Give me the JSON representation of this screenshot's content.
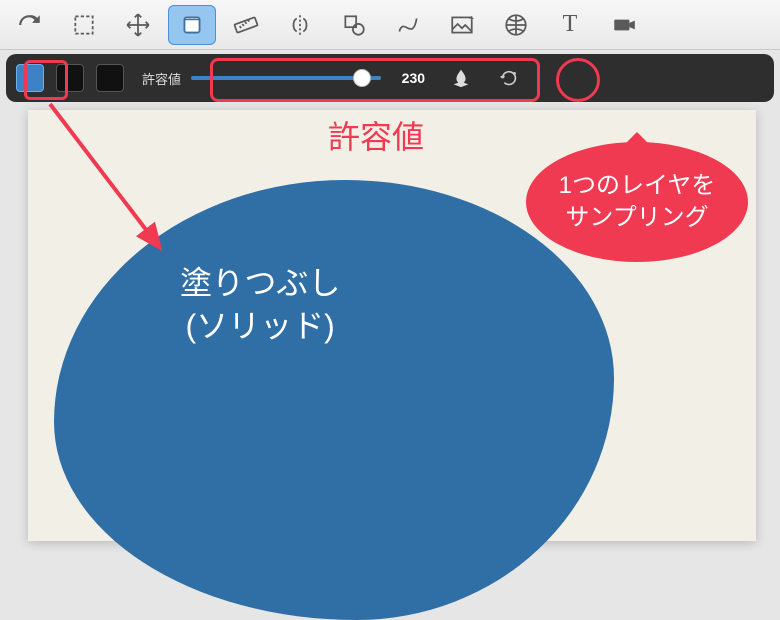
{
  "toolbar": {
    "tools": [
      {
        "name": "redo-arrow"
      },
      {
        "name": "marquee-select"
      },
      {
        "name": "move"
      },
      {
        "name": "fill-bucket",
        "selected": true
      },
      {
        "name": "ruler"
      },
      {
        "name": "symmetry"
      },
      {
        "name": "shape"
      },
      {
        "name": "curve"
      },
      {
        "name": "image-insert"
      },
      {
        "name": "perspective-grid"
      },
      {
        "name": "text"
      },
      {
        "name": "camera"
      }
    ]
  },
  "options": {
    "swatches": [
      {
        "color": "blue"
      },
      {
        "color": "black"
      },
      {
        "color": "black"
      }
    ],
    "tolerance_label": "許容値",
    "tolerance_value": "230",
    "tolerance_percent": 90,
    "sample_layer_icon": "drop-layers",
    "reset_icon": "reset-rotate"
  },
  "canvas": {
    "fill_label": "塗りつぶし\n(ソリッド)"
  },
  "annotations": {
    "tolerance_heading": "許容値",
    "bubble_text_line1": "1つのレイヤを",
    "bubble_text_line2": "サンプリング"
  }
}
